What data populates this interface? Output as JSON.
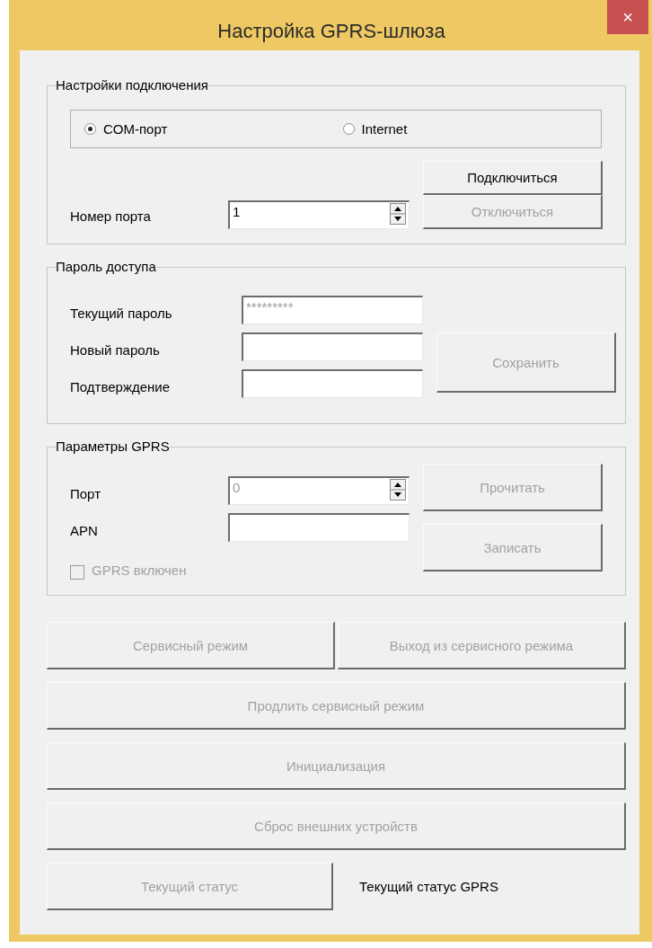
{
  "window": {
    "title": "Настройка GPRS-шлюза",
    "close_glyph": "×"
  },
  "connection": {
    "legend": "Настройки подключения",
    "modes": [
      {
        "label": "COM-порт",
        "selected": true
      },
      {
        "label": "Internet",
        "selected": false
      }
    ],
    "port_label": "Номер порта",
    "port_value": "1",
    "buttons": [
      {
        "label": "Подключиться",
        "disabled": false
      },
      {
        "label": "Отключиться",
        "disabled": true
      }
    ]
  },
  "password": {
    "legend": "Пароль доступа",
    "fields": [
      {
        "label": "Текущий пароль",
        "value": "*********",
        "disabled": true
      },
      {
        "label": "Новый пароль"
      },
      {
        "label": "Подтверждение"
      }
    ],
    "save_button": {
      "label": "Сохранить",
      "disabled": true
    }
  },
  "gprs": {
    "legend": "Параметры GPRS",
    "port_label": "Порт",
    "port_value": "0",
    "port_disabled": true,
    "apn_label": "APN",
    "enabled_checkbox": {
      "label": "GPRS включен",
      "checked": false,
      "disabled": true
    },
    "buttons": [
      {
        "label": "Прочитать",
        "disabled": true
      },
      {
        "label": "Записать",
        "disabled": true
      }
    ]
  },
  "service_buttons": [
    {
      "label": "Сервисный режим",
      "disabled": true
    },
    {
      "label": "Выход из сервисного режима",
      "disabled": true
    }
  ],
  "action_buttons": [
    {
      "label": "Продлить сервисный режим",
      "disabled": true
    },
    {
      "label": "Инициализация",
      "disabled": true
    },
    {
      "label": "Сброс внешних устройств",
      "disabled": true
    }
  ],
  "status": {
    "button": {
      "label": "Текущий статус",
      "disabled": true
    },
    "label": "Текущий статус GPRS"
  }
}
